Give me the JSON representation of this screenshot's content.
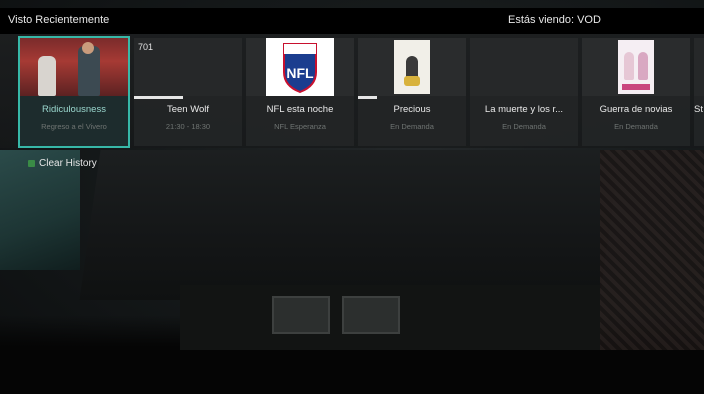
{
  "header": {
    "title": "Visto Recientemente",
    "status": "Estás viendo: VOD"
  },
  "recent": [
    {
      "name": "Ridiculousness",
      "sub": "Regreso a el Vivero",
      "progress": 0.0
    },
    {
      "name": "Teen Wolf",
      "sub": "21:30 - 18:30",
      "channel": "701",
      "progress": 0.45
    },
    {
      "name": "NFL esta noche",
      "sub": "NFL Esperanza",
      "progress": 0.0
    },
    {
      "name": "Precious",
      "sub": "En Demanda",
      "progress": 0.18
    },
    {
      "name": "La muerte y los r...",
      "sub": "En Demanda",
      "progress": 0.0
    },
    {
      "name": "Guerra de novias",
      "sub": "En Demanda",
      "progress": 0.0
    },
    {
      "name": "St",
      "sub": "",
      "progress": 0.0
    }
  ],
  "clear_history": "Clear History",
  "colors": {
    "selection": "#37b8a8",
    "clear_icon": "#3a8b46"
  }
}
